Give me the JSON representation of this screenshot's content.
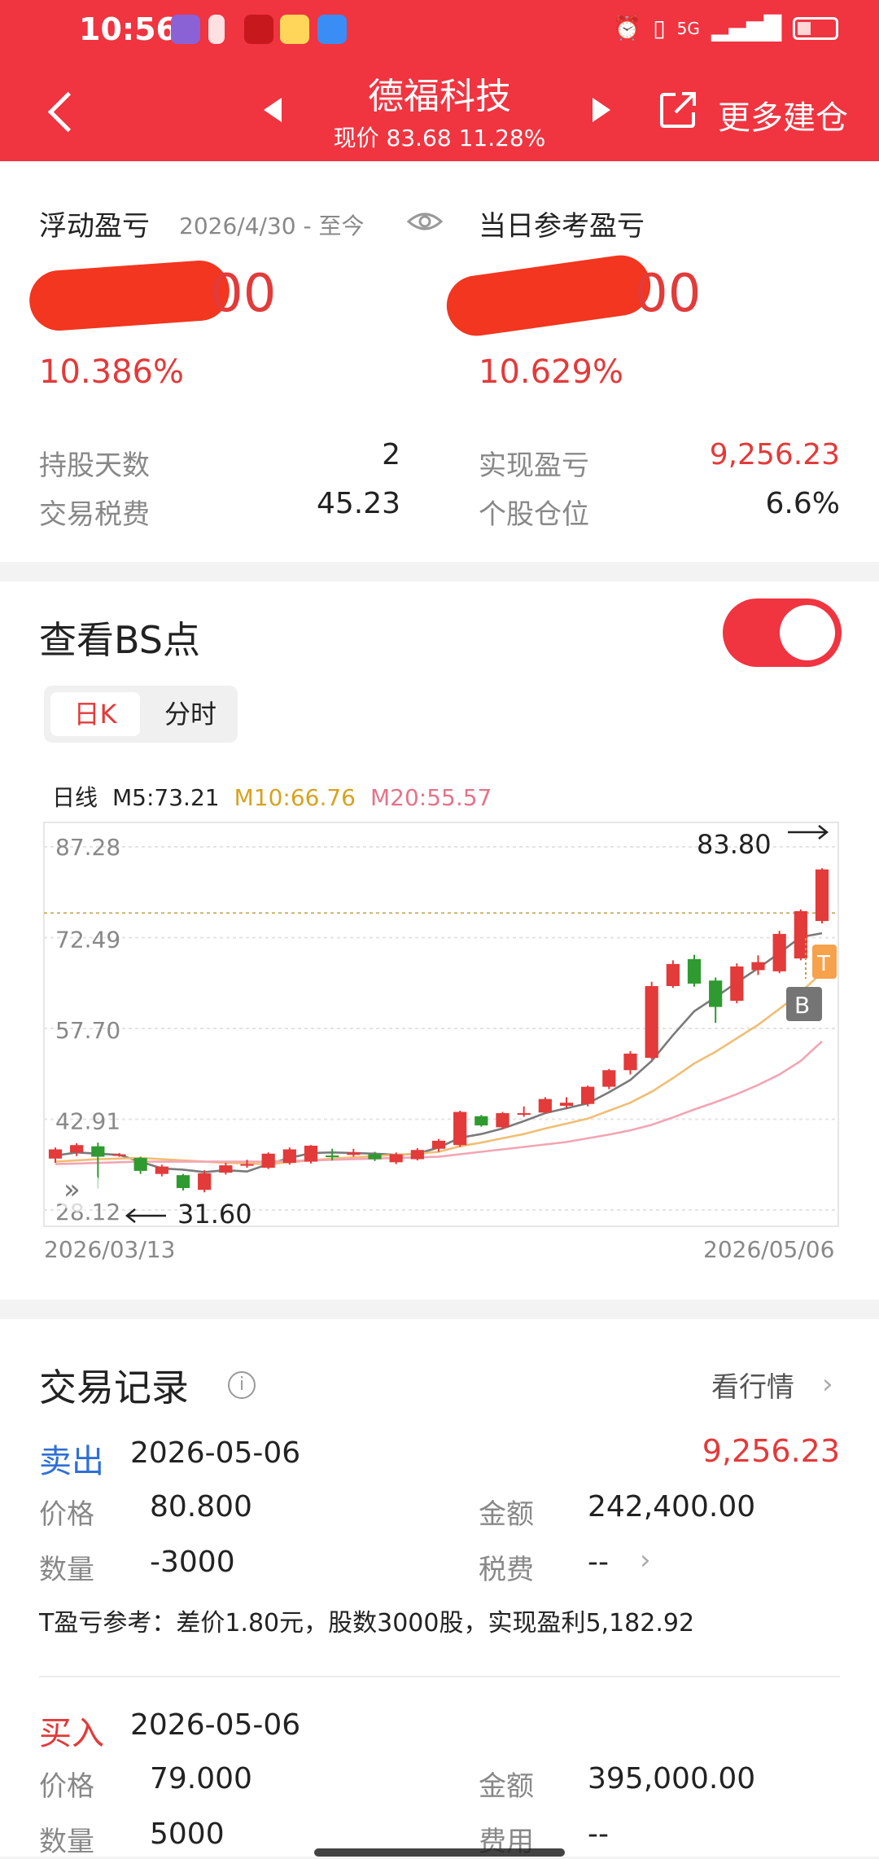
{
  "status_bar": {
    "time": "10:56",
    "signal": "5G"
  },
  "header": {
    "stock_name": "德福科技",
    "price_line": "现价 83.68 11.28%",
    "more_label": "更多建仓"
  },
  "summary": {
    "float_pl_label": "浮动盈亏",
    "float_pl_range": "2026/4/30 - 至今",
    "float_pl_value_suffix": "00",
    "float_pl_pct": "10.386%",
    "daily_pl_label": "当日参考盈亏",
    "daily_pl_value_suffix": "00",
    "daily_pl_pct": "10.629%",
    "hold_days_label": "持股天数",
    "hold_days": "2",
    "fee_label": "交易税费",
    "fee": "45.23",
    "realized_label": "实现盈亏",
    "realized": "9,256.23",
    "position_label": "个股仓位",
    "position": "6.6%"
  },
  "bs": {
    "title": "查看BS点",
    "toggle_on": true,
    "tabs": [
      "日K",
      "分时"
    ],
    "ma_prefix": "日线",
    "ma5": "M5:73.21",
    "ma10": "M10:66.76",
    "ma20": "M20:55.57",
    "start_date": "2026/03/13",
    "end_date": "2026/05/06",
    "high_label": "83.80",
    "low_label": "31.60",
    "t_marker": "T",
    "b_marker": "B"
  },
  "chart_data": {
    "type": "candlestick",
    "y_ticks": [
      "87.28",
      "72.49",
      "57.70",
      "42.91",
      "28.12"
    ],
    "ylim": [
      28.12,
      87.28
    ],
    "x_range": [
      "2026/03/13",
      "2026/05/06"
    ],
    "candles": [
      [
        36.5,
        38.0,
        35.8,
        38.3
      ],
      [
        37.5,
        38.7,
        36.9,
        39.0
      ],
      [
        38.5,
        36.8,
        31.6,
        39.1
      ],
      [
        37.2,
        37.2,
        36.8,
        37.4
      ],
      [
        36.6,
        34.5,
        34.0,
        36.8
      ],
      [
        34.0,
        35.2,
        33.6,
        35.5
      ],
      [
        33.8,
        31.7,
        31.3,
        34.0
      ],
      [
        31.4,
        34.1,
        31.0,
        34.6
      ],
      [
        34.2,
        35.4,
        33.9,
        35.8
      ],
      [
        35.4,
        35.6,
        35.0,
        36.3
      ],
      [
        35.0,
        37.3,
        34.8,
        37.5
      ],
      [
        35.8,
        38.0,
        35.5,
        38.3
      ],
      [
        36.0,
        38.6,
        35.7,
        38.7
      ],
      [
        37.0,
        36.8,
        36.2,
        38.1
      ],
      [
        37.1,
        37.5,
        36.8,
        38.1
      ],
      [
        37.2,
        36.4,
        36.1,
        37.6
      ],
      [
        35.9,
        37.2,
        35.6,
        37.5
      ],
      [
        36.4,
        37.9,
        36.2,
        38.2
      ],
      [
        38.1,
        39.4,
        37.6,
        39.7
      ],
      [
        38.7,
        44.1,
        38.4,
        44.3
      ],
      [
        43.4,
        41.9,
        41.7,
        43.6
      ],
      [
        41.6,
        43.9,
        41.3,
        44.1
      ],
      [
        43.8,
        43.9,
        43.3,
        45.0
      ],
      [
        44.0,
        46.2,
        43.8,
        46.5
      ],
      [
        45.1,
        45.6,
        44.6,
        46.5
      ],
      [
        45.4,
        48.2,
        45.0,
        48.4
      ],
      [
        48.2,
        50.9,
        47.8,
        51.1
      ],
      [
        50.9,
        53.6,
        50.2,
        54.0
      ],
      [
        52.9,
        64.6,
        52.7,
        65.3
      ],
      [
        64.6,
        68.2,
        64.3,
        68.8
      ],
      [
        69.0,
        65.0,
        64.5,
        69.7
      ],
      [
        65.5,
        61.2,
        58.6,
        66.0
      ],
      [
        62.2,
        67.8,
        61.8,
        68.3
      ],
      [
        67.2,
        68.5,
        66.4,
        69.6
      ],
      [
        67.0,
        73.1,
        66.7,
        73.6
      ],
      [
        69.1,
        76.8,
        68.8,
        77.1
      ],
      [
        75.2,
        83.6,
        74.8,
        83.8
      ]
    ],
    "ma5": [
      37.0,
      37.5,
      37.3,
      37.1,
      36.0,
      34.9,
      34.7,
      34.3,
      34.6,
      34.4,
      35.6,
      36.6,
      37.4,
      37.5,
      37.4,
      37.3,
      37.1,
      37.3,
      38.3,
      39.9,
      40.5,
      41.4,
      42.6,
      43.9,
      44.7,
      45.5,
      47.3,
      49.3,
      52.4,
      56.6,
      60.5,
      62.8,
      65.2,
      67.5,
      70.0,
      72.6,
      73.2
    ],
    "ma10": [
      36.0,
      36.2,
      36.4,
      36.5,
      36.6,
      36.4,
      36.2,
      36.0,
      35.8,
      35.7,
      35.6,
      35.9,
      36.2,
      36.5,
      36.7,
      36.9,
      37.1,
      37.3,
      37.6,
      38.5,
      39.1,
      39.8,
      40.5,
      41.4,
      42.2,
      43.0,
      44.3,
      45.6,
      47.4,
      49.6,
      52.0,
      53.9,
      56.1,
      58.3,
      60.9,
      63.6,
      66.8
    ],
    "ma20": [
      35.6,
      35.7,
      35.8,
      35.9,
      36.0,
      36.0,
      36.0,
      36.0,
      36.0,
      36.0,
      36.0,
      36.1,
      36.2,
      36.3,
      36.4,
      36.5,
      36.6,
      36.7,
      36.8,
      37.2,
      37.6,
      38.0,
      38.4,
      38.8,
      39.2,
      39.8,
      40.4,
      41.1,
      42.0,
      43.2,
      44.5,
      45.7,
      47.0,
      48.5,
      50.2,
      52.4,
      55.6
    ],
    "ref_price": 76.5,
    "grid": true
  },
  "colors": {
    "up": "#e33a3a",
    "down": "#2f9a2f",
    "ma5": "#7a7a7a",
    "ma10": "#f0be74",
    "ma20": "#f2a5b4",
    "brand": "#f03440"
  },
  "trades": {
    "title": "交易记录",
    "link_label": "看行情",
    "records": [
      {
        "side": "卖出",
        "date": "2026-05-06",
        "amount_pl": "9,256.23",
        "price_label": "价格",
        "price": "80.800",
        "amount_label": "金额",
        "amount": "242,400.00",
        "qty_label": "数量",
        "qty": "-3000",
        "fee_label": "税费",
        "fee": "--",
        "note": "T盈亏参考：差价1.80元，股数3000股，实现盈利5,182.92"
      },
      {
        "side": "买入",
        "date": "2026-05-06",
        "price_label": "价格",
        "price": "79.000",
        "amount_label": "金额",
        "amount": "395,000.00",
        "qty_label": "数量",
        "qty": "5000",
        "fee_label": "费用",
        "fee": "--"
      }
    ]
  }
}
